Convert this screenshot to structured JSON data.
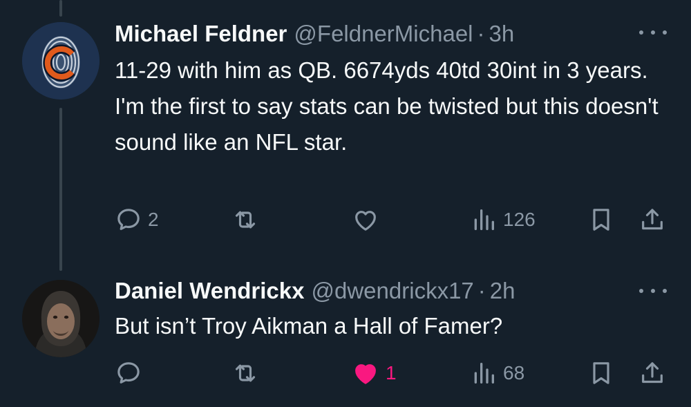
{
  "tweets": [
    {
      "name": "Michael Feldner",
      "handle": "@FeldnerMichael",
      "separator": "·",
      "time": "3h",
      "text": "11-29 with him as QB. 6674yds 40td 30int in 3 years. I'm the first to say stats can be twisted but this doesn't sound like an NFL star.",
      "replies": "2",
      "reposts": "",
      "likes": "",
      "views": "126",
      "liked": false
    },
    {
      "name": "Daniel Wendrickx",
      "handle": "@dwendrickx17",
      "separator": "·",
      "time": "2h",
      "text": "But isn’t Troy Aikman a Hall of Famer?",
      "replies": "",
      "reposts": "",
      "likes": "1",
      "views": "68",
      "liked": true
    }
  ],
  "colors": {
    "background": "#15202b",
    "text": "#f7f9f9",
    "secondary": "#8b98a5",
    "like": "#f91880",
    "thread_line": "#38444d"
  },
  "icons": [
    "reply-icon",
    "repost-icon",
    "like-icon",
    "views-icon",
    "bookmark-icon",
    "share-icon",
    "more-icon"
  ]
}
